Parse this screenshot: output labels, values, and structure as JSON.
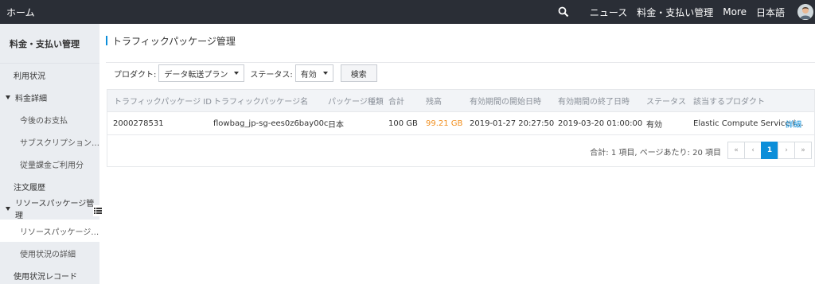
{
  "topbar": {
    "home": "ホーム",
    "links": [
      "ニュース",
      "料金・支払い管理",
      "More",
      "日本語"
    ],
    "icons": {
      "search": "search-icon",
      "avatar": "avatar"
    }
  },
  "sidebar": {
    "header": "料金・支払い管理",
    "items": [
      {
        "label": "利用状況"
      },
      {
        "label": "料金詳細"
      },
      {
        "label": "今後のお支払"
      },
      {
        "label": "サブスクリプション…"
      },
      {
        "label": "従量課金ご利用分"
      },
      {
        "label": "注文履歴"
      },
      {
        "label": "リソースパッケージ管理"
      },
      {
        "label": "リソースパッケージ…"
      },
      {
        "label": "使用状況の詳細"
      },
      {
        "label": "使用状況レコード"
      }
    ]
  },
  "page": {
    "title": "トラフィックパッケージ管理"
  },
  "filter": {
    "product_label": "プロダクト:",
    "product_value": "データ転送プラン",
    "status_label": "ステータス:",
    "status_value": "有効",
    "search_button": "検索"
  },
  "table": {
    "headers": [
      "トラフィックパッケージ ID",
      "トラフィックパッケージ名",
      "パッケージ種類",
      "合計",
      "残高",
      "有効期間の開始日時",
      "有効期間の終了日時",
      "ステータス",
      "該当するプロダクト"
    ],
    "rows": [
      {
        "id": "2000278531",
        "name": "flowbag_jp-sg-ees0z6bay00c",
        "type": "日本",
        "total": "100 GB",
        "balance": "99.21 GB",
        "start": "2019-01-27 20:27:50",
        "end": "2019-03-20 01:00:00",
        "status": "有効",
        "product": "Elastic Compute Service (…",
        "detail_link": "詳細"
      }
    ]
  },
  "pagination": {
    "summary": "合計: 1 項目,  ページあたり: 20 項目",
    "first": "«",
    "prev": "‹",
    "current": "1",
    "next": "›",
    "last": "»"
  },
  "colors": {
    "accent": "#0c8ed9",
    "topbar": "#2a2e36",
    "balance": "#f18e1d"
  }
}
